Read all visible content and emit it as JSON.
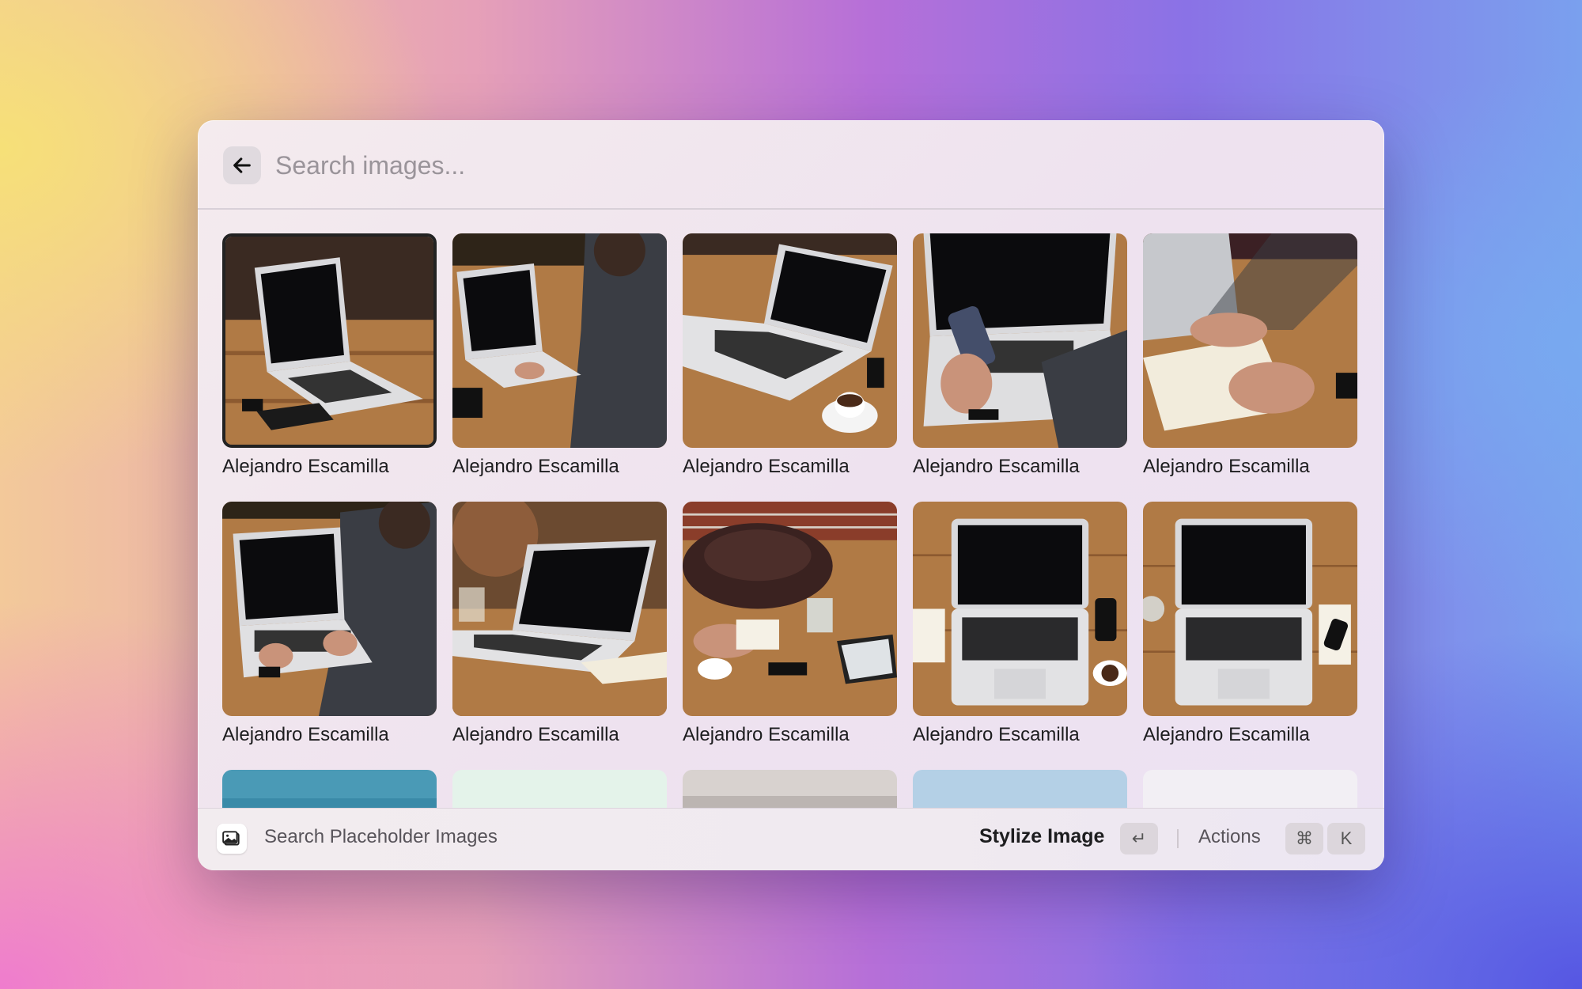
{
  "search": {
    "placeholder": "Search images..."
  },
  "results": {
    "items": [
      {
        "author": "Alejandro Escamilla",
        "scene": "laptop-on-table-with-notebook",
        "selected": true
      },
      {
        "author": "Alejandro Escamilla",
        "scene": "person-typing-on-laptop"
      },
      {
        "author": "Alejandro Escamilla",
        "scene": "laptop-with-coffee-cup"
      },
      {
        "author": "Alejandro Escamilla",
        "scene": "person-holding-phone-at-laptop"
      },
      {
        "author": "Alejandro Escamilla",
        "scene": "person-writing-in-notebook"
      },
      {
        "author": "Alejandro Escamilla",
        "scene": "person-typing-on-laptop-closeup"
      },
      {
        "author": "Alejandro Escamilla",
        "scene": "laptop-blurred-background"
      },
      {
        "author": "Alejandro Escamilla",
        "scene": "desk-with-bag-and-tablet"
      },
      {
        "author": "Alejandro Escamilla",
        "scene": "laptop-top-view-with-phone"
      },
      {
        "author": "Alejandro Escamilla",
        "scene": "laptop-top-view-with-glass"
      }
    ],
    "partial_row": [
      {
        "scene": "teal-sky"
      },
      {
        "scene": "pale-mint"
      },
      {
        "scene": "grey-horizon"
      },
      {
        "scene": "light-blue-sky"
      },
      {
        "scene": "white-fog"
      }
    ]
  },
  "footer": {
    "title": "Search Placeholder Images",
    "primary_action": "Stylize Image",
    "primary_key": "↵",
    "actions_label": "Actions",
    "actions_keys": [
      "⌘",
      "K"
    ]
  },
  "colors": {
    "wood": "#b07a45",
    "screen": "#0b0b0d",
    "laptop": "#d9d9dc",
    "selection_border": "#222222"
  }
}
